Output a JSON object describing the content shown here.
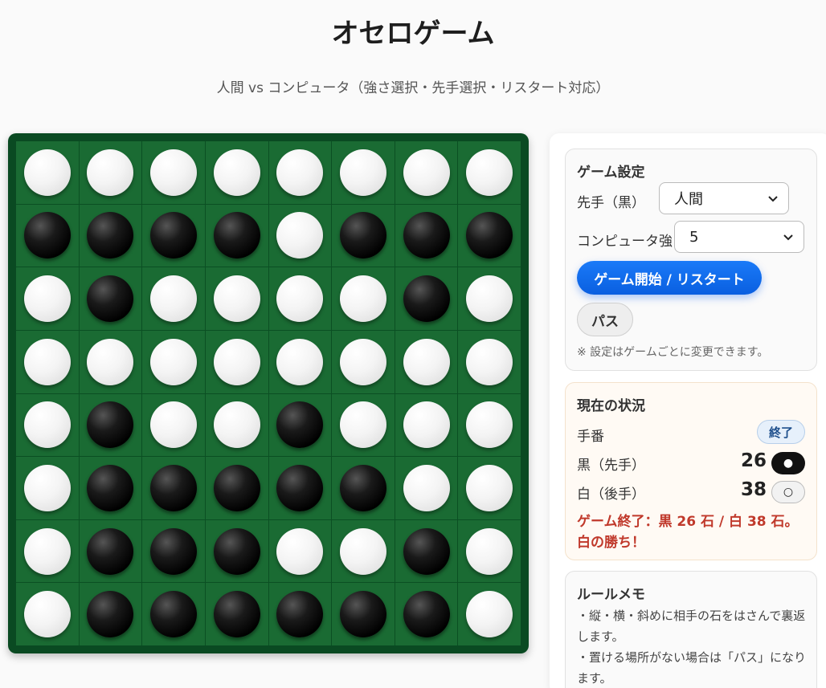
{
  "header": {
    "title": "オセロゲーム",
    "subtitle": "人間 vs コンピュータ（強さ選択・先手選択・リスタート対応）"
  },
  "board": {
    "rows": [
      "WWWWWWWW",
      "BBBBWBBB",
      "WBWWWWBW",
      "WWWWWWWW",
      "WBWWBWWW",
      "WBBBBBWW",
      "WBBBWWBW",
      "WBBBBBBW"
    ]
  },
  "settings": {
    "title": "ゲーム設定",
    "first_player_label": "先手（黒）",
    "first_player_value": "人間",
    "strength_label": "コンピュータ強さ",
    "strength_value": "5",
    "start_button": "ゲーム開始 / リスタート",
    "pass_button": "パス",
    "note": "※ 設定はゲームごとに変更できます。"
  },
  "status": {
    "title": "現在の状況",
    "turn_label": "手番",
    "turn_value": "終了",
    "black_label": "黒（先手）",
    "black_count": "26",
    "black_symbol": "●",
    "white_label": "白（後手）",
    "white_count": "38",
    "white_symbol": "○",
    "result": "ゲーム終了：黒 26 石 / 白 38 石。白の勝ち！"
  },
  "rules": {
    "title": "ルールメモ",
    "line1": "・縦・横・斜めに相手の石をはさんで裏返します。",
    "line2": "・置ける場所がない場合は「パス」になります。"
  },
  "colors": {
    "board": "#1a6b33",
    "primary": "#0a5fe0",
    "result": "#c0392b"
  }
}
